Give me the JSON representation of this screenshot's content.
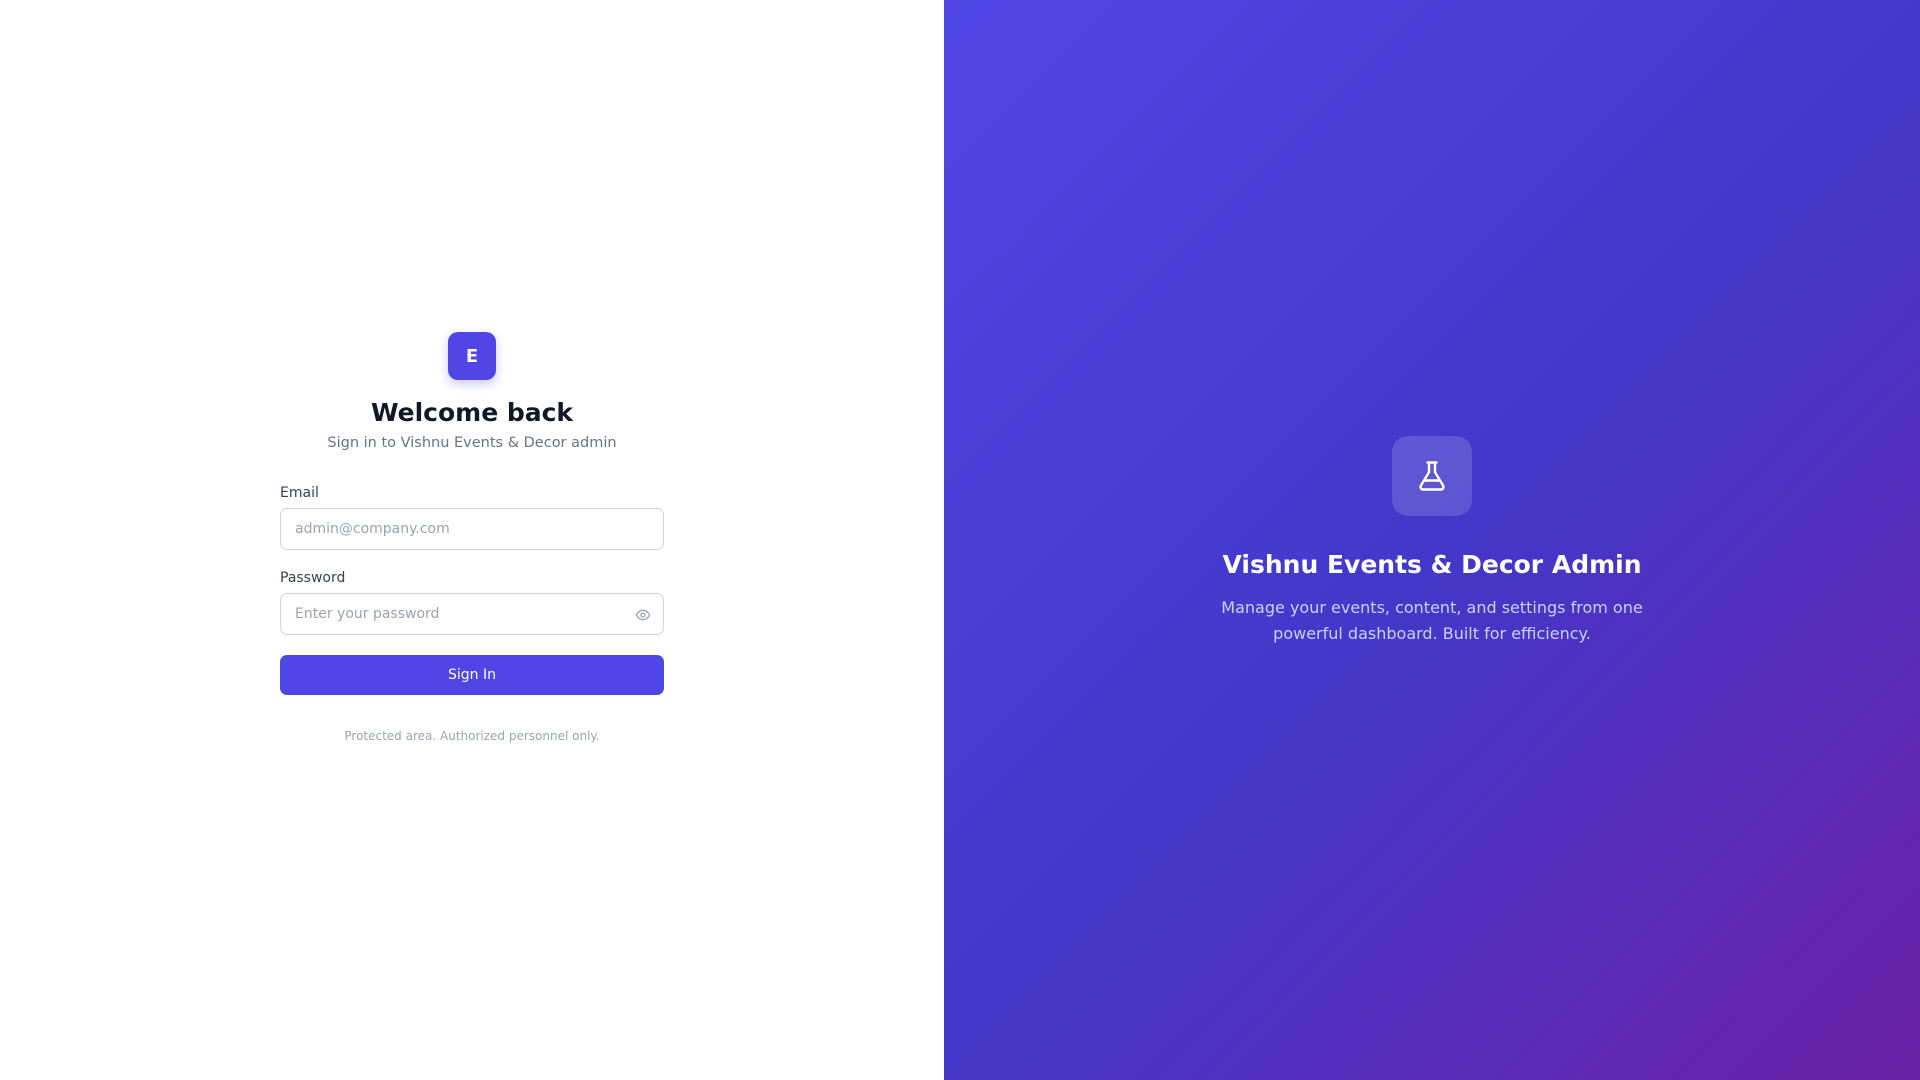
{
  "login": {
    "logo_letter": "E",
    "title": "Welcome back",
    "subtitle": "Sign in to Vishnu Events & Decor admin",
    "email": {
      "label": "Email",
      "placeholder": "admin@company.com",
      "value": ""
    },
    "password": {
      "label": "Password",
      "placeholder": "Enter your password",
      "value": "",
      "toggle_icon": "eye-icon"
    },
    "submit_label": "Sign In",
    "footnote": "Protected area. Authorized personnel only."
  },
  "hero": {
    "icon": "flask-icon",
    "title": "Vishnu Events & Decor Admin",
    "description": "Manage your events, content, and settings from one powerful dashboard. Built for efficiency."
  },
  "colors": {
    "accent": "#4f46e5",
    "gradient_start": "#4f46e5",
    "gradient_end": "#6b21a8",
    "heading": "#111827",
    "muted": "#6b7280"
  }
}
